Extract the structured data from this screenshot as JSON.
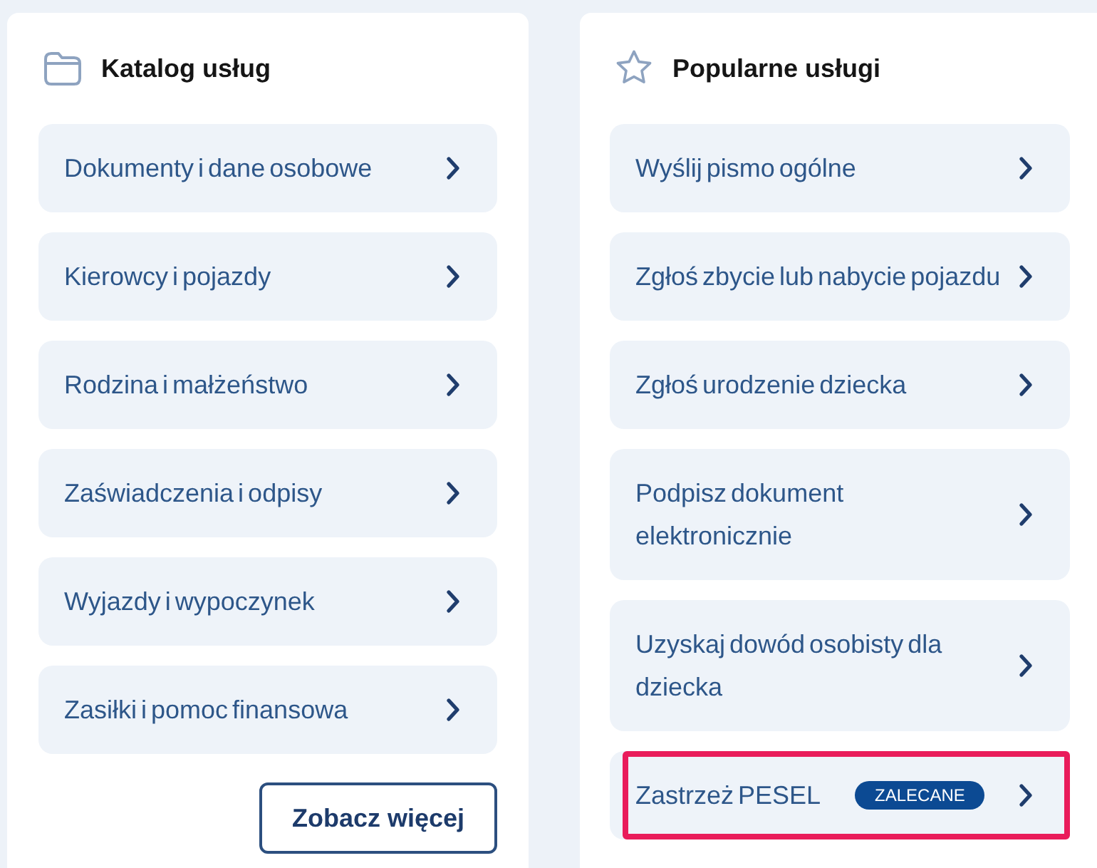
{
  "catalog": {
    "title": "Katalog usług",
    "items": [
      {
        "label": "Dokumenty i dane osobowe"
      },
      {
        "label": "Kierowcy i pojazdy"
      },
      {
        "label": "Rodzina i małżeństwo"
      },
      {
        "label": "Zaświadczenia i odpisy"
      },
      {
        "label": "Wyjazdy i wypoczynek"
      },
      {
        "label": "Zasiłki i pomoc finansowa"
      }
    ],
    "more_button": "Zobacz więcej"
  },
  "popular": {
    "title": "Popularne usługi",
    "items": [
      {
        "label": "Wyślij pismo ogólne",
        "highlighted": false
      },
      {
        "label": "Zgłoś zbycie lub nabycie pojazdu",
        "highlighted": false
      },
      {
        "label": "Zgłoś urodzenie dziecka",
        "highlighted": false
      },
      {
        "label": "Podpisz dokument elektronicznie",
        "highlighted": false
      },
      {
        "label": "Uzyskaj dowód osobisty dla dziecka",
        "highlighted": false
      },
      {
        "label": "Zastrzeż PESEL",
        "badge": "ZALECANE",
        "highlighted": true
      }
    ]
  }
}
